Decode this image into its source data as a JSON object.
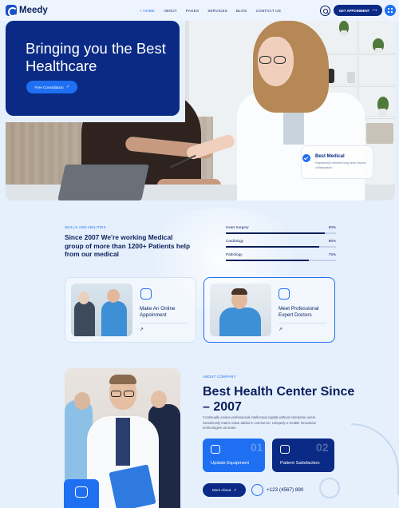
{
  "brand": {
    "name": "Meedy"
  },
  "nav": {
    "items": [
      {
        "label": "+ HOME",
        "active": true
      },
      {
        "label": "ABOUT",
        "active": false
      },
      {
        "label": "PAGES",
        "active": false
      },
      {
        "label": "SERVICES",
        "active": false
      },
      {
        "label": "BLOG",
        "active": false
      },
      {
        "label": "CONTACT US",
        "active": false
      }
    ],
    "cta_label": "GET APPOINMENT",
    "cta_arrow": "⟶"
  },
  "hero": {
    "title": "Bringing you the Best Healthcare",
    "cta_label": "Free Consultation",
    "cta_arrow": "↗",
    "badge_title": "Best Medical",
    "badge_text": "Rapidiously reinvent long-term impact collaboration"
  },
  "skills": {
    "eyebrow": "SKILLS AND ABILITIES",
    "heading": "Since 2007 We're working Medical group of more than 1200+ Patients help from our medical",
    "items": [
      {
        "label": "Heart Surgery",
        "value": 90,
        "value_text": "90%"
      },
      {
        "label": "Cardiology",
        "value": 85,
        "value_text": "85%"
      },
      {
        "label": "Pathology",
        "value": 75,
        "value_text": "75%"
      }
    ]
  },
  "services": [
    {
      "title": "Make An Online Appoinment",
      "arrow": "↗"
    },
    {
      "title": "Meet Professional Expert Doctors",
      "arrow": "↗"
    }
  ],
  "about": {
    "eyebrow": "ABOUT COMPANY",
    "heading": "Best Health Center Since – 2007",
    "text": "Continually evolve professional intellectual capital without enterprise users. Seamlessly matrix value added e-commerce. Uniquely e-enable innovative technologies via team",
    "features": [
      {
        "num": "01",
        "label": "Update Equipment",
        "color": "#1f6ff2"
      },
      {
        "num": "02",
        "label": "Patient Satisfaction",
        "color": "#0a2a85"
      }
    ],
    "more_label": "More About",
    "more_arrow": "↗",
    "phone": "+123 (4567) 890"
  },
  "colors": {
    "navy": "#0a2a85",
    "accent": "#1f6ff2",
    "background": "#e6f0fc"
  }
}
